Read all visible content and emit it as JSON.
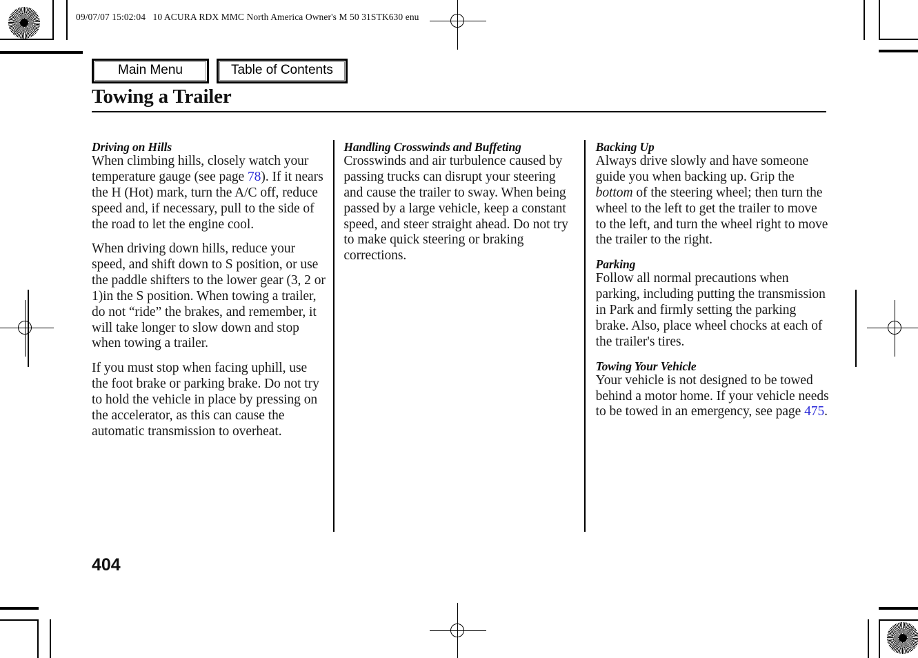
{
  "document": {
    "header_line": "09/07/07 15:02:04   10 ACURA RDX MMC North America Owner's M 50 31STK630 enu",
    "title": "Towing a Trailer",
    "page_number": "404",
    "link_color": "#2b2bd8"
  },
  "nav": {
    "main_menu_label": "Main Menu",
    "table_of_contents_label": "Table of Contents"
  },
  "columns": {
    "col1": {
      "sections": [
        {
          "heading": "Driving on Hills",
          "paragraphs": [
            {
              "runs": [
                {
                  "text": "When climbing hills, closely watch your temperature gauge (see page "
                },
                {
                  "text": "78",
                  "style": "link"
                },
                {
                  "text": "). If it nears the H (Hot) mark, turn the A/C off, reduce speed and, if necessary, pull to the side of the road to let the engine cool."
                }
              ]
            },
            {
              "runs": [
                {
                  "text": "When driving down hills, reduce your speed, and shift down to S position, or use the paddle shifters to the lower gear (3, 2 or 1)in the S position. When towing a trailer, do not “ride” the brakes, and remember, it will take longer to slow down and stop when towing a trailer."
                }
              ]
            },
            {
              "runs": [
                {
                  "text": "If you must stop when facing uphill, use the foot brake or parking brake. Do not try to hold the vehicle in place by pressing on the accelerator, as this can cause the automatic transmission to overheat."
                }
              ]
            }
          ]
        }
      ]
    },
    "col2": {
      "sections": [
        {
          "heading": "Handling Crosswinds and Buffeting",
          "paragraphs": [
            {
              "runs": [
                {
                  "text": "Crosswinds and air turbulence caused by passing trucks can disrupt your steering and cause the trailer to sway. When being passed by a large vehicle, keep a constant speed, and steer straight ahead. Do not try to make quick steering or braking corrections."
                }
              ]
            }
          ]
        }
      ]
    },
    "col3": {
      "sections": [
        {
          "heading": "Backing Up",
          "paragraphs": [
            {
              "runs": [
                {
                  "text": "Always drive slowly and have someone guide you when backing up. Grip the "
                },
                {
                  "text": "bottom",
                  "style": "italic"
                },
                {
                  "text": " of the steering wheel; then turn the wheel to the left to get the trailer to move to the left, and turn the wheel right to move the trailer to the right."
                }
              ]
            }
          ]
        },
        {
          "heading": "Parking",
          "paragraphs": [
            {
              "runs": [
                {
                  "text": "Follow all normal precautions when parking, including putting the transmission in Park and firmly setting the parking brake. Also, place wheel chocks at each of the trailer's tires."
                }
              ]
            }
          ]
        },
        {
          "heading": "Towing Your Vehicle",
          "paragraphs": [
            {
              "runs": [
                {
                  "text": "Your vehicle is not designed to be towed behind a motor home. If your vehicle needs to be towed in an emergency, see page "
                },
                {
                  "text": "475",
                  "style": "link"
                },
                {
                  "text": "."
                }
              ]
            }
          ]
        }
      ]
    }
  }
}
